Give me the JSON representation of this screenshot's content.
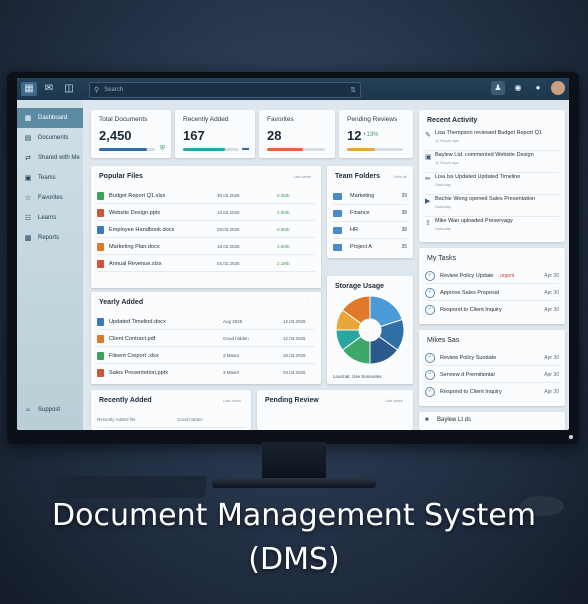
{
  "topbar": {
    "search_placeholder": "Search"
  },
  "sidebar": {
    "items": [
      {
        "label": "Dashboard",
        "icon": "grid-icon"
      },
      {
        "label": "Documents",
        "icon": "document-icon"
      },
      {
        "label": "Shared with Me",
        "icon": "share-icon"
      },
      {
        "label": "Teams",
        "icon": "teams-icon"
      },
      {
        "label": "Favorites",
        "icon": "star-icon"
      },
      {
        "label": "Learns",
        "icon": "book-icon"
      },
      {
        "label": "Reports",
        "icon": "chart-icon"
      }
    ],
    "bottom": "Suppost"
  },
  "stats": [
    {
      "title": "Total Documents",
      "value": "2,450",
      "fill": 0.85,
      "color": "#2f6fa8"
    },
    {
      "title": "Recently Added",
      "value": "167",
      "fill": 0.75,
      "color": "#2aa6a0"
    },
    {
      "title": "Favorites",
      "value": "28",
      "fill": 0.62,
      "color": "#e0663a"
    },
    {
      "title": "Pending Reviews",
      "value": "12",
      "extra": "+13%",
      "fill": 0.5,
      "color": "#e8a53a"
    }
  ],
  "popular": {
    "title": "Popular Files",
    "sub": "Last week",
    "files": [
      {
        "name": "Budget Report Q1.xlsx",
        "date": "30.03.2025",
        "size": "9.3Mb",
        "color": "#3e9f5a"
      },
      {
        "name": "Website Design.pptx",
        "date": "12.03.2025",
        "size": "2.8Mb",
        "color": "#d0543a"
      },
      {
        "name": "Employee Handbook.docx",
        "date": "03.03.2025",
        "size": "9.8Mb",
        "color": "#3a7ac0"
      },
      {
        "name": "Marketing Plan.docx",
        "date": "18.02.2025",
        "size": "2.6Mb",
        "color": "#e07a2a"
      },
      {
        "name": "Annual Revenue.xlsx",
        "date": "04.02.2025",
        "size": "2.1Mb",
        "color": "#d8503a"
      }
    ]
  },
  "folders": {
    "title": "Team Folders",
    "sub": "View all",
    "items": [
      {
        "name": "Marketing",
        "count": "39"
      },
      {
        "name": "Finance",
        "count": "38"
      },
      {
        "name": "HR",
        "count": "38"
      },
      {
        "name": "Project A",
        "count": "35"
      }
    ]
  },
  "yearly": {
    "title": "Yearly Added",
    "files": [
      {
        "name": "Updated Timelind.docx",
        "tag": "Aug 2025",
        "date": "12.03.2025",
        "color": "#3a7ac0"
      },
      {
        "name": "Client Contract.pdf",
        "tag": "Good hidden",
        "date": "12.03.2025",
        "color": "#e07a2a"
      },
      {
        "name": "Fileent Creport .xlsx",
        "tag": "3 Maset",
        "date": "10.03.2025",
        "color": "#3e9f5a"
      },
      {
        "name": "Sales Presentetion.pptx",
        "tag": "3 Maset",
        "date": "04.03.2025",
        "color": "#d0543a"
      }
    ]
  },
  "storage": {
    "title": "Storage Usage",
    "legend": "Lourmat, Use Somoutes",
    "slices": [
      {
        "value": 20,
        "color": "#4a9ad8"
      },
      {
        "value": 15,
        "color": "#2f6fa8"
      },
      {
        "value": 15,
        "color": "#2d5a8c"
      },
      {
        "value": 15,
        "color": "#3ea86a"
      },
      {
        "value": 10,
        "color": "#2aa6a0"
      },
      {
        "value": 10,
        "color": "#e8a53a"
      },
      {
        "value": 15,
        "color": "#e07a2a"
      }
    ]
  },
  "recently": {
    "title": "Recently Added",
    "sub": "Last week",
    "r1": "Recently Added file",
    "r2": "Good hidden"
  },
  "pending": {
    "title": "Pending Review",
    "sub": "Last week"
  },
  "activity": {
    "title": "Recent Activity",
    "items": [
      {
        "text": "Lisa Thempson reviewed Budget Report Q1",
        "sub": "11 Hours ago"
      },
      {
        "text": "Baylew Ltd. commented Website Design",
        "sub": "11 Hours ago"
      },
      {
        "text": "Lisa Iss Updated Updated Timeline",
        "sub": "Saturday"
      },
      {
        "text": "Bachie Wong opened Sales Presentation",
        "sub": "Saturday"
      },
      {
        "text": "Mike Wan uploaded Preservagy",
        "sub": "Saturday"
      }
    ]
  },
  "mytasks": {
    "title": "My Tasks",
    "items": [
      {
        "label": "Review Policy Update",
        "urgent": "urgent",
        "due": "Apr 30"
      },
      {
        "label": "Approve Sales Proposal",
        "due": "Apr 30"
      },
      {
        "label": "Respond to Client Inquiry",
        "due": "Apr 30"
      }
    ]
  },
  "mikesas": {
    "title": "Mikes Sas",
    "items": [
      {
        "label": "Review Policy Suodate",
        "due": "Apr 30"
      },
      {
        "label": "Serview d Premitiontal",
        "due": "Apr 30"
      },
      {
        "label": "Respond to Client Inquiry",
        "due": "Apr 30"
      }
    ]
  },
  "bottomcard": {
    "title": "Baylew Lt ds"
  },
  "caption": {
    "line1": "Document Management System",
    "line2": "(DMS)"
  }
}
